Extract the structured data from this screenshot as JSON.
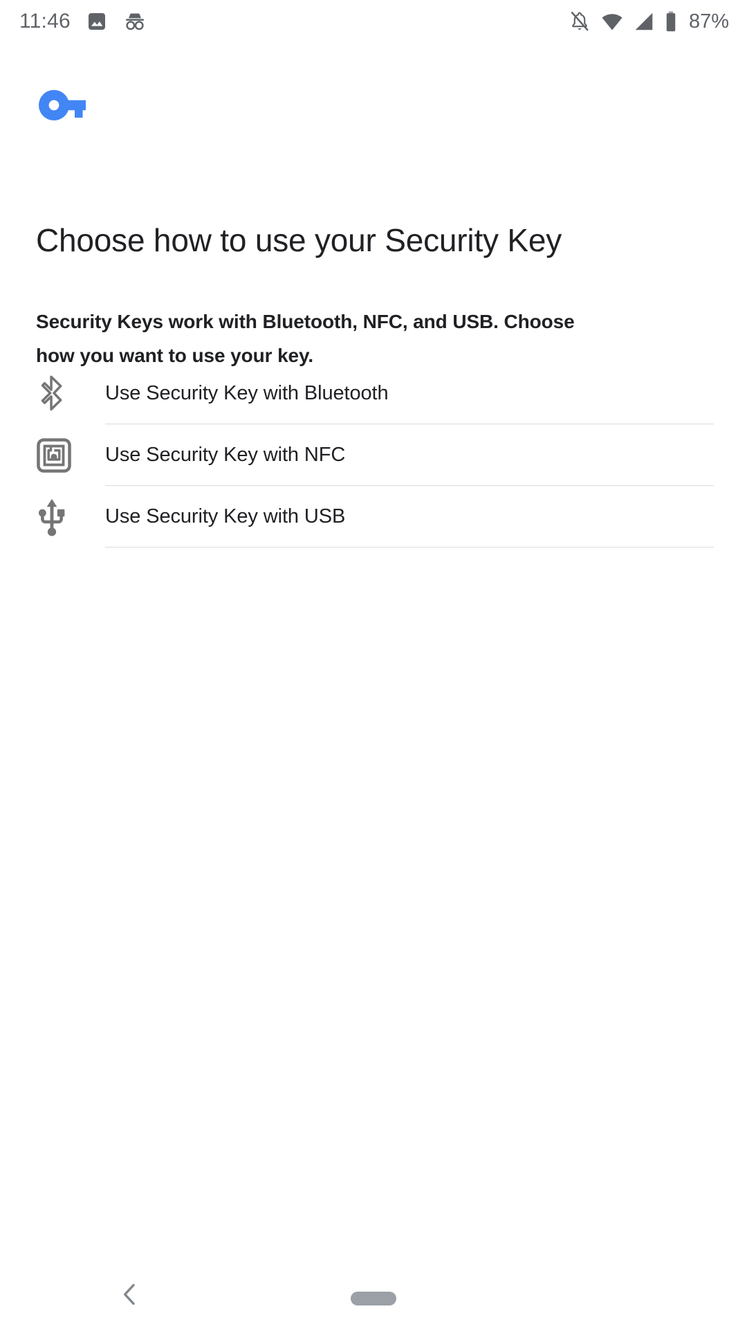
{
  "status_bar": {
    "clock": "11:46",
    "battery_percent": "87%",
    "left_icons": [
      {
        "name": "image-icon",
        "label": "Screenshot"
      },
      {
        "name": "incognito-icon",
        "label": "Incognito"
      }
    ],
    "right_icons": [
      {
        "name": "notifications-off-icon",
        "label": "Notifications silenced"
      },
      {
        "name": "wifi-icon",
        "label": "Wi-Fi"
      },
      {
        "name": "cellular-signal-icon",
        "label": "Mobile signal"
      },
      {
        "name": "battery-icon",
        "label": "Battery"
      }
    ],
    "icon_color": "#5f6368"
  },
  "branding": {
    "logo_icon": "key-icon",
    "logo_color": "#4285f4"
  },
  "page": {
    "title": "Choose how to use your Security Key",
    "body": "Security Keys work with Bluetooth, NFC, and USB. Choose how you want to use your key.",
    "text_color": "#202124"
  },
  "options": [
    {
      "icon": "bluetooth-icon",
      "label": "Use Security Key with Bluetooth"
    },
    {
      "icon": "nfc-icon",
      "label": "Use Security Key with NFC"
    },
    {
      "icon": "usb-icon",
      "label": "Use Security Key with USB"
    }
  ],
  "divider_color": "#dadce0",
  "nav_bar": {
    "back_label": "Back",
    "home_handle_label": "Home",
    "color": "#80868b"
  }
}
